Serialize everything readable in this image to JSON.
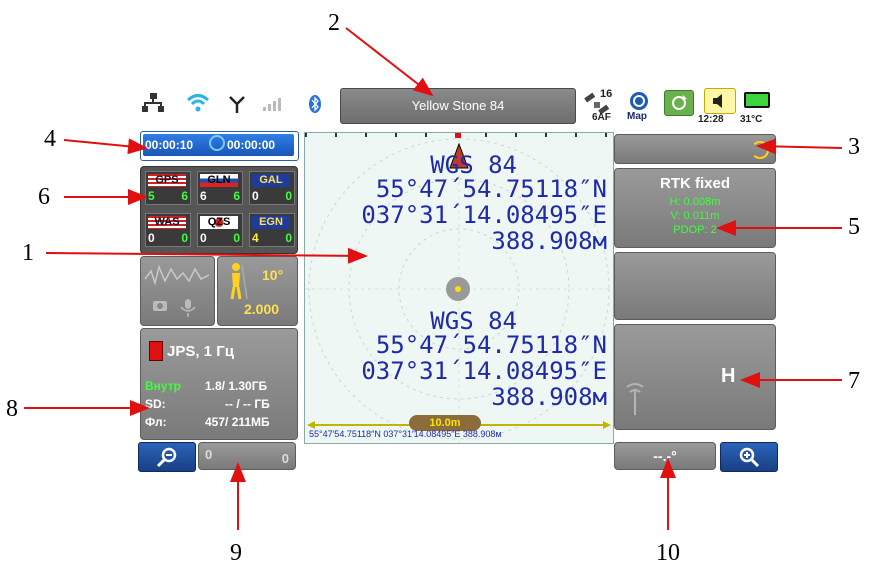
{
  "callouts": [
    "1",
    "2",
    "3",
    "4",
    "5",
    "6",
    "7",
    "8",
    "9",
    "10"
  ],
  "status_bar": {
    "project_name": "Yellow Stone 84",
    "sat_count": "16",
    "sat_label": "6AF",
    "map_label": "Map",
    "time": "12:28",
    "temperature": "31°C"
  },
  "timer": {
    "elapsed": "00:00:10",
    "remaining": "00:00:00"
  },
  "satellites": [
    {
      "label": "GPS",
      "v1": "5",
      "v2": "6"
    },
    {
      "label": "GLN",
      "v1": "6",
      "v2": "6"
    },
    {
      "label": "GAL",
      "v1": "0",
      "v2": "0"
    },
    {
      "label": "WAS",
      "v1": "0",
      "v2": "0"
    },
    {
      "label": "QZS",
      "v1": "0",
      "v2": "0"
    },
    {
      "label": "EGN",
      "v1": "4",
      "v2": "0"
    }
  ],
  "tilt": {
    "angle": "10°",
    "value": "2.000"
  },
  "recording": {
    "format": "JPS, 1 Гц",
    "rows": [
      {
        "label": "Внутр",
        "value": "1.8/ 1.30ГБ"
      },
      {
        "label": "SD:",
        "value": "-- / -- ГБ"
      },
      {
        "label": "Фл:",
        "value": "457/ 211МБ"
      }
    ]
  },
  "bottom_left_counter": {
    "left": "0",
    "right": "0"
  },
  "map": {
    "block1": {
      "datum": "WGS 84",
      "lat": "55°47´54.75118″N",
      "lon": "037°31´14.08495″E",
      "height": "388.908м"
    },
    "block2": {
      "datum": "WGS 84",
      "lat": "55°47´54.75118″N",
      "lon": "037°31´14.08495″E",
      "height": "388.908м"
    },
    "scale": "10.0m",
    "footer": "55°47′54.75118″N 037°31′14.08495″E 388.908м"
  },
  "rtk": {
    "status": "RTK fixed",
    "lines": [
      "H: 0.008m",
      "V: 0.011m",
      "PDOP: 2"
    ]
  },
  "h_label": "H",
  "angle_readout": "--.-°",
  "colors": {
    "blue_text": "#1f2aa8",
    "green_text": "#3dff3d",
    "yellow_text": "#ffeb3b",
    "red": "#e01010"
  }
}
